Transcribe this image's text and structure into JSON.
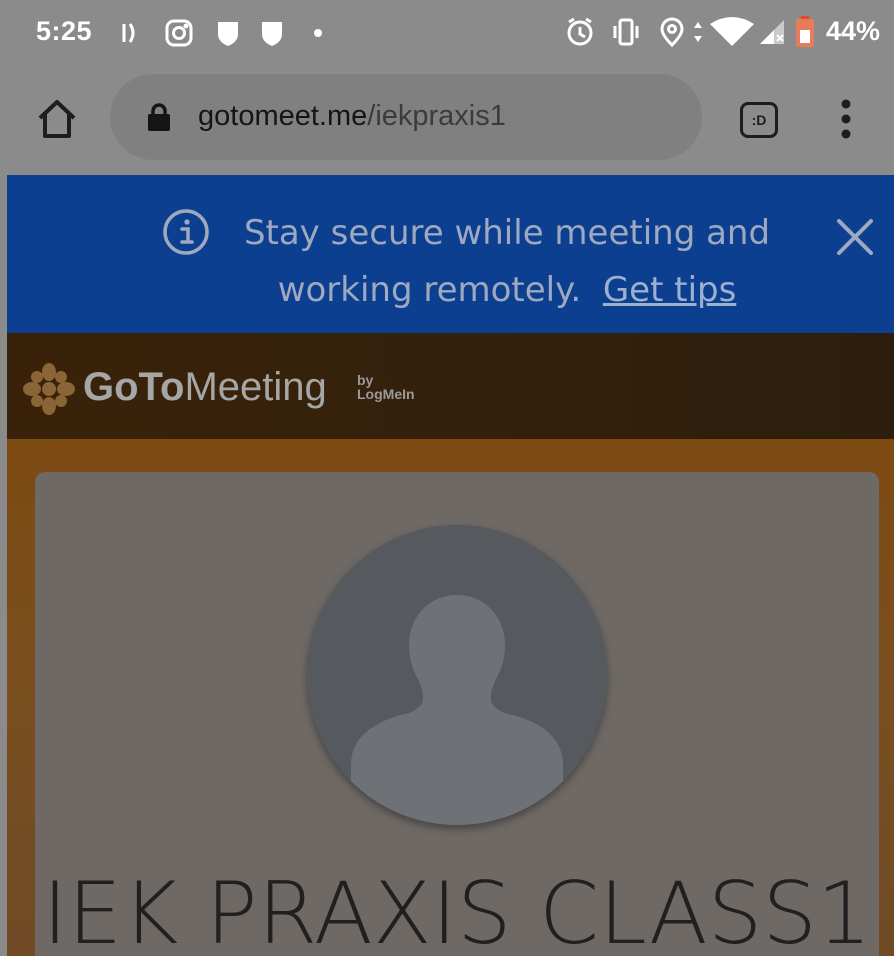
{
  "status_bar": {
    "time": "5:25",
    "battery_percent": "44%",
    "left_icons": [
      "voicemail-icon",
      "instagram-icon",
      "shield-icon",
      "shield-icon",
      "dot-icon"
    ],
    "right_icons": [
      "alarm-icon",
      "vibrate-icon",
      "location-icon",
      "wifi-icon",
      "signal-icon",
      "battery-icon"
    ]
  },
  "browser": {
    "url_domain": "gotomeet.me",
    "url_path": "/iekpraxis1",
    "tabs_label": ":D"
  },
  "banner": {
    "message": "Stay secure while meeting and working remotely.",
    "link_text": "Get tips",
    "color": "#0d3f91"
  },
  "brand": {
    "logo_goto": "GoTo",
    "logo_meeting": "Meeting",
    "by_line": "by",
    "company": "LogMeIn",
    "accent_color": "#e8a33b"
  },
  "meeting": {
    "room_name": "IEK PRAXIS CLASS1"
  }
}
